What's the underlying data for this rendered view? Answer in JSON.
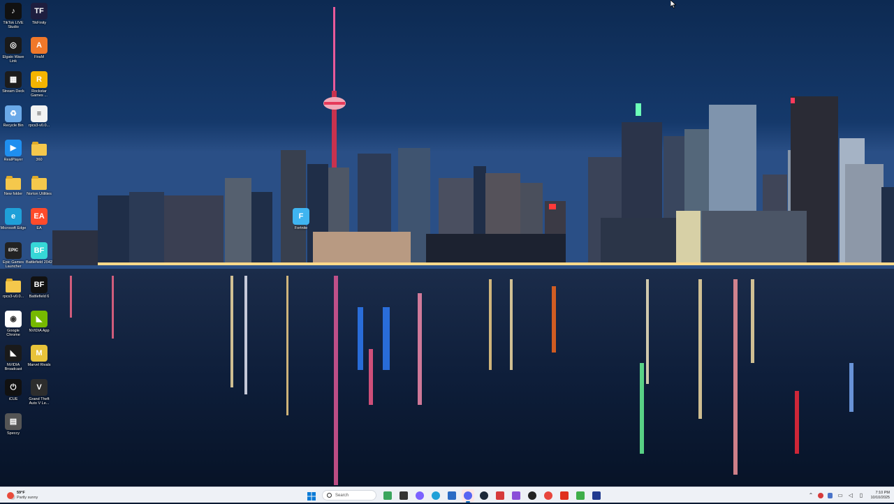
{
  "desktop": {
    "icons": [
      {
        "label": "TikTok LIVE Studio",
        "icon": "tiktok-live-icon",
        "color": "#111111"
      },
      {
        "label": "TikFinity",
        "icon": "tikfinity-icon",
        "color": "#1e1e3f"
      },
      {
        "label": "Elgato Wave Link",
        "icon": "elgato-wave-link-icon",
        "color": "#1a1a1a"
      },
      {
        "label": "FiraM",
        "icon": "firam-icon",
        "color": "#f0782a"
      },
      {
        "label": "Stream Deck",
        "icon": "stream-deck-icon",
        "color": "#1c1c1c"
      },
      {
        "label": "Rockstar Games ...",
        "icon": "rockstar-icon",
        "color": "#f4b400"
      },
      {
        "label": "Recycle Bin",
        "icon": "recycle-bin-icon",
        "color": "#6aa9e8"
      },
      {
        "label": "rpcs3-v0.0...",
        "icon": "document-icon",
        "color": "#f2f2f2"
      },
      {
        "label": "RealPlayer",
        "icon": "realplayer-icon",
        "color": "#1f8ff0"
      },
      {
        "label": "360",
        "icon": "folder-icon",
        "color": "#f5c84c"
      },
      {
        "label": "New folder",
        "icon": "folder-icon",
        "color": "#f5c84c"
      },
      {
        "label": "Norton Utilities ...",
        "icon": "folder-icon",
        "color": "#f5c84c"
      },
      {
        "label": "Microsoft Edge",
        "icon": "edge-icon",
        "color": "#1fa0d8"
      },
      {
        "label": "EA",
        "icon": "ea-icon",
        "color": "#ff4b2b"
      },
      {
        "label": "Epic Games Launcher",
        "icon": "epic-games-icon",
        "color": "#222222"
      },
      {
        "label": "Battlefield 2042",
        "icon": "battlefield-2042-icon",
        "color": "#36d7d7"
      },
      {
        "label": "rpcs3-v0.0...",
        "icon": "rpcs3-folder-icon",
        "color": "#f5c84c"
      },
      {
        "label": "Battlefield 6",
        "icon": "battlefield-6-icon",
        "color": "#111111"
      },
      {
        "label": "Google Chrome",
        "icon": "chrome-icon",
        "color": "#ffffff"
      },
      {
        "label": "NVIDIA App",
        "icon": "nvidia-app-icon",
        "color": "#76b900"
      },
      {
        "label": "NVIDIA Broadcast",
        "icon": "nvidia-broadcast-icon",
        "color": "#1a1a1a"
      },
      {
        "label": "Marvel Rivals",
        "icon": "marvel-rivals-icon",
        "color": "#e8c33a"
      },
      {
        "label": "iCUE",
        "icon": "icue-icon",
        "color": "#111111"
      },
      {
        "label": "Grand Theft Auto V Le...",
        "icon": "gta-v-icon",
        "color": "#2d2d2d"
      },
      {
        "label": "Speccy",
        "icon": "speccy-icon",
        "color": "#555555"
      }
    ],
    "fortnite": {
      "label": "Fortnite",
      "icon": "fortnite-icon",
      "color": "#3fb4f0"
    }
  },
  "taskbar": {
    "weather": {
      "temp": "59°F",
      "condition": "Partly sunny",
      "icon": "weather-icon"
    },
    "search": {
      "placeholder": "Search"
    },
    "apps": [
      {
        "name": "start-button",
        "icon": "windows-start-icon",
        "color": "#0078d4"
      },
      {
        "name": "search"
      },
      {
        "name": "widgets-button",
        "icon": "widgets-icon",
        "color": "#3ba55d"
      },
      {
        "name": "task-view-button",
        "icon": "task-view-icon",
        "color": "#333333"
      },
      {
        "name": "copilot-button",
        "icon": "copilot-icon",
        "color": "#7b61ff"
      },
      {
        "name": "edge-taskbar-button",
        "icon": "edge-icon",
        "color": "#1fa0d8"
      },
      {
        "name": "store-taskbar-button",
        "icon": "microsoft-store-icon",
        "color": "#2b6cc4"
      },
      {
        "name": "discord-taskbar-button",
        "icon": "discord-icon",
        "color": "#5865f2",
        "highlight": true
      },
      {
        "name": "steam-taskbar-button",
        "icon": "steam-icon",
        "color": "#1b2838"
      },
      {
        "name": "app-red-taskbar-button",
        "icon": "game-controller-icon",
        "color": "#d63a3a"
      },
      {
        "name": "folder-taskbar-button",
        "icon": "file-explorer-icon",
        "color": "#8a4fd8"
      },
      {
        "name": "obs-taskbar-button",
        "icon": "obs-icon",
        "color": "#222222"
      },
      {
        "name": "chrome-taskbar-button",
        "icon": "chrome-icon",
        "color": "#e8453c"
      },
      {
        "name": "text-app-taskbar-button",
        "icon": "text-app-icon",
        "color": "#e0301e"
      },
      {
        "name": "nvidia-taskbar-button",
        "icon": "nvidia-app-icon",
        "color": "#3fae49"
      },
      {
        "name": "media-taskbar-button",
        "icon": "media-app-icon",
        "color": "#223b8f"
      }
    ],
    "tray": {
      "icons": [
        "chevron-up-icon",
        "app-tray-icon",
        "shield-tray-icon",
        "network-icon",
        "volume-icon",
        "battery-icon"
      ],
      "time": "7:10 PM",
      "date": "10/10/2025"
    }
  }
}
